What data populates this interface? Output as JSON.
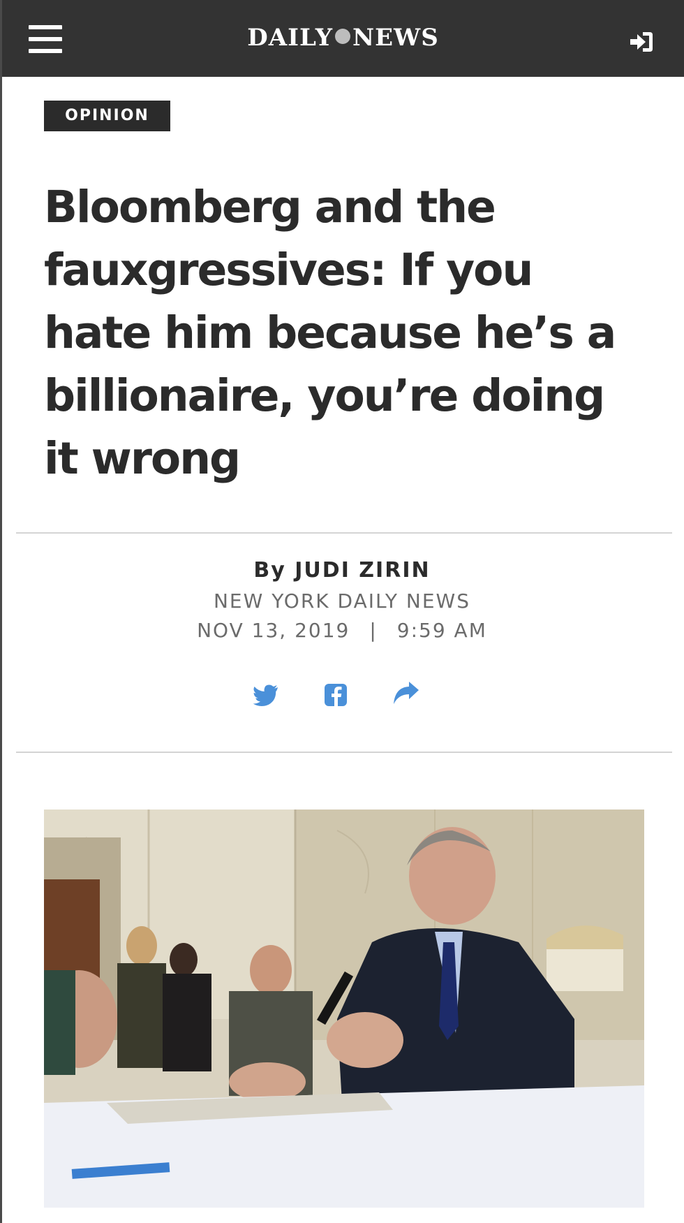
{
  "header": {
    "logo_left": "DAILY",
    "logo_right": "NEWS"
  },
  "icons": {
    "menu": "hamburger-menu-icon",
    "login": "sign-in-icon",
    "twitter": "twitter-icon",
    "facebook": "facebook-icon",
    "share": "share-arrow-icon"
  },
  "colors": {
    "topbar": "#333333",
    "text": "#2b2b2b",
    "muted": "#6b6b6b",
    "share_blue": "#4a90d9"
  },
  "article": {
    "section": "OPINION",
    "headline": "Bloomberg and the fauxgressives: If you hate him because he’s a billionaire, you’re doing it wrong",
    "byline_prefix": "By",
    "author": "JUDI ZIRIN",
    "source": "NEW YORK DAILY NEWS",
    "date": "NOV 13, 2019",
    "separator": "|",
    "time": "9:59 AM"
  }
}
